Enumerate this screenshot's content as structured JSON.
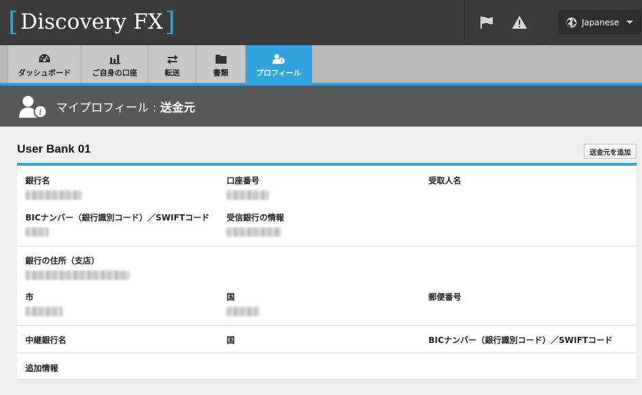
{
  "header": {
    "logo": {
      "open": "[",
      "text": "Discovery FX",
      "close": "]"
    },
    "icons": [
      "flag-icon",
      "warning-icon"
    ],
    "language": {
      "selected": "Japanese"
    }
  },
  "nav": {
    "tabs": [
      {
        "label": "ダッシュボード",
        "icon": "dashboard-icon",
        "active": false
      },
      {
        "label": "ご自身の口座",
        "icon": "bar-chart-icon",
        "active": false
      },
      {
        "label": "転送",
        "icon": "transfer-arrows-icon",
        "active": false
      },
      {
        "label": "書類",
        "icon": "folder-icon",
        "active": false
      },
      {
        "label": "プロフィール",
        "icon": "profile-info-icon",
        "active": true
      }
    ]
  },
  "page": {
    "title_main": "マイプロフィール",
    "title_sep": " : ",
    "title_bold": "送金元"
  },
  "bank": {
    "title": "User Bank 01",
    "add_button": "送金元を追加",
    "labels": {
      "bank_name": "銀行名",
      "account_number": "口座番号",
      "recipient_name": "受取人名",
      "bic_swift": "BICナンバー（銀行識別コード）／SWIFTコード",
      "receiving_bank_info": "受信銀行の情報",
      "bank_address": "銀行の住所（支店）",
      "city": "市",
      "country": "国",
      "postal_code": "郵便番号",
      "intermediary_bank_name": "中継銀行名",
      "intermediary_country": "国",
      "intermediary_bic_swift": "BICナンバー（銀行識別コード）／SWIFTコード",
      "additional_info": "追加情報"
    }
  },
  "colors": {
    "accent": "#2ea3dc",
    "header_bg": "#3b3b3b",
    "title_band_bg": "#595959",
    "nav_bg": "#c7c7c7"
  }
}
